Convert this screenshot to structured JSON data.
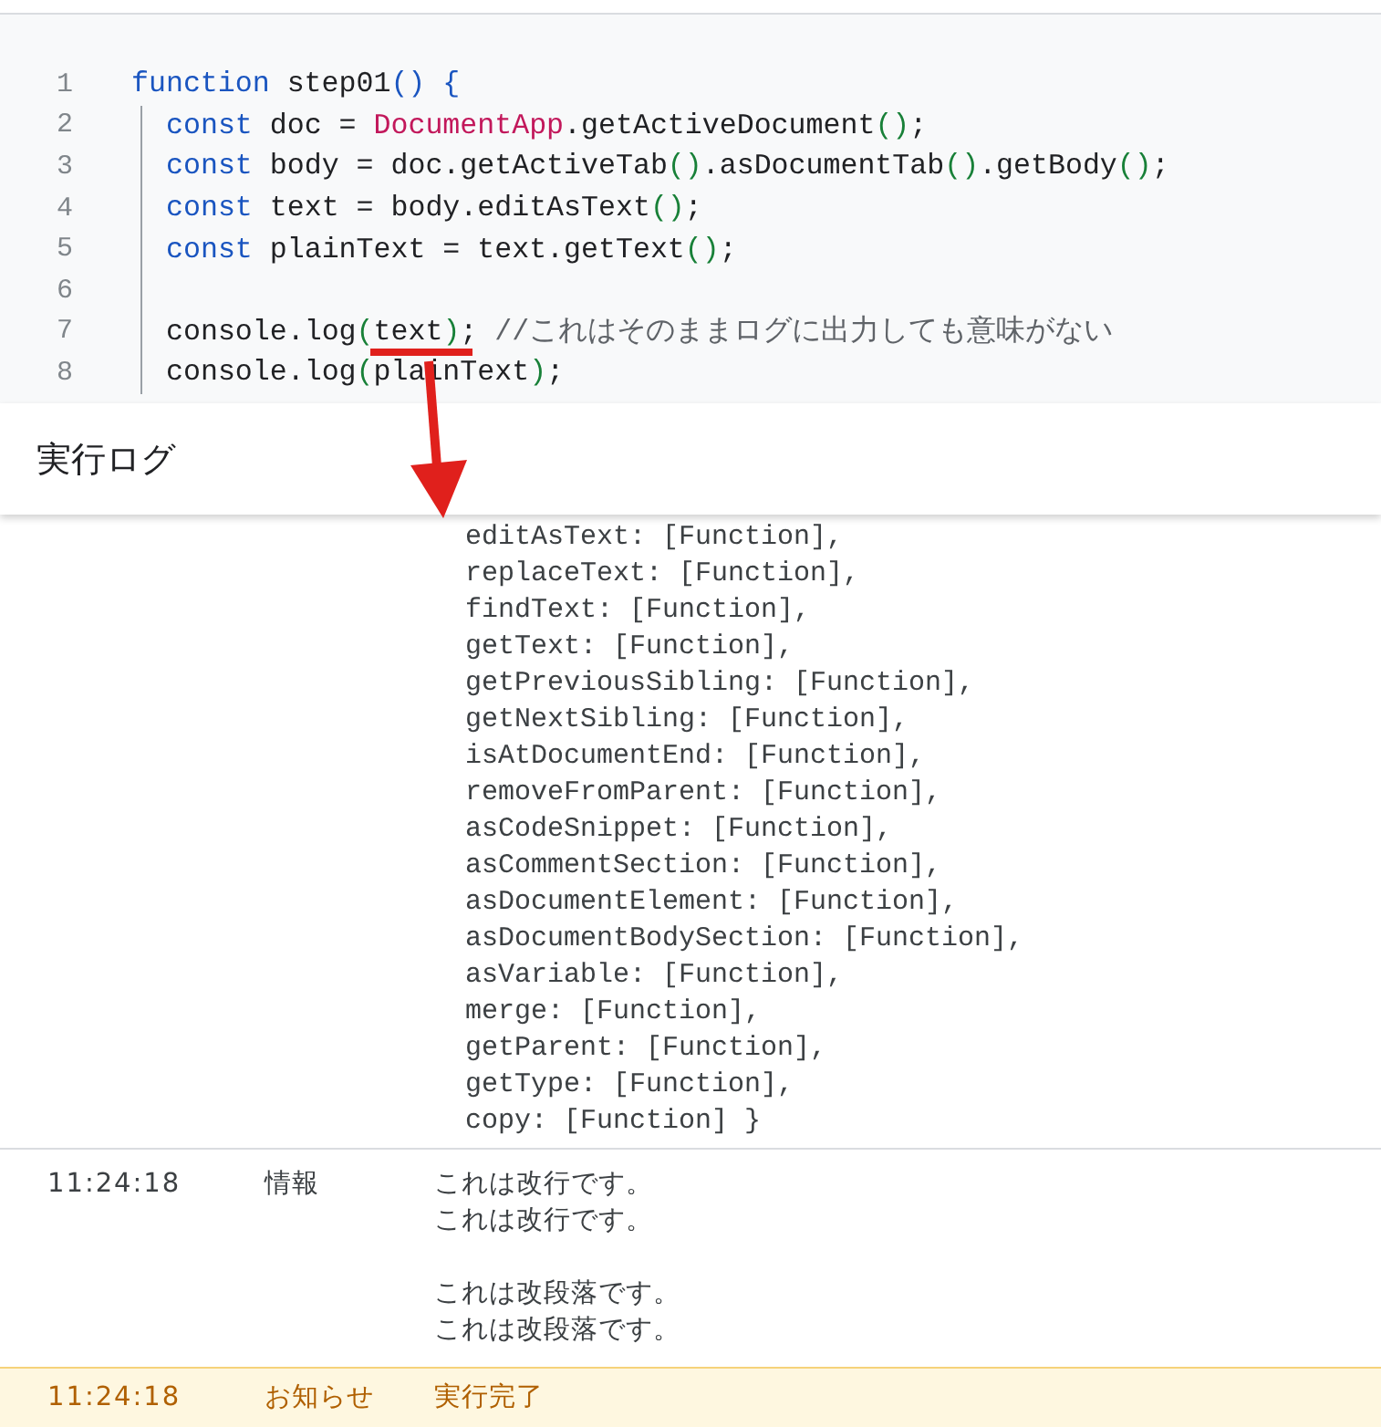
{
  "editor": {
    "lines": [
      {
        "number": "1",
        "indented": false,
        "tokens": [
          {
            "kind": "keyword",
            "text": "function"
          },
          {
            "kind": "plain",
            "text": " step01"
          },
          {
            "kind": "bracket",
            "text": "() {"
          }
        ]
      },
      {
        "number": "2",
        "indented": true,
        "tokens": [
          {
            "kind": "keyword",
            "text": "const"
          },
          {
            "kind": "plain",
            "text": " doc = "
          },
          {
            "kind": "class",
            "text": "DocumentApp"
          },
          {
            "kind": "plain",
            "text": ".getActiveDocument"
          },
          {
            "kind": "paren",
            "text": "()"
          },
          {
            "kind": "plain",
            "text": ";"
          }
        ]
      },
      {
        "number": "3",
        "indented": true,
        "tokens": [
          {
            "kind": "keyword",
            "text": "const"
          },
          {
            "kind": "plain",
            "text": " body = doc.getActiveTab"
          },
          {
            "kind": "paren",
            "text": "()"
          },
          {
            "kind": "plain",
            "text": ".asDocumentTab"
          },
          {
            "kind": "paren",
            "text": "()"
          },
          {
            "kind": "plain",
            "text": ".getBody"
          },
          {
            "kind": "paren",
            "text": "()"
          },
          {
            "kind": "plain",
            "text": ";"
          }
        ]
      },
      {
        "number": "4",
        "indented": true,
        "tokens": [
          {
            "kind": "keyword",
            "text": "const"
          },
          {
            "kind": "plain",
            "text": " text = body.editAsText"
          },
          {
            "kind": "paren",
            "text": "()"
          },
          {
            "kind": "plain",
            "text": ";"
          }
        ]
      },
      {
        "number": "5",
        "indented": true,
        "tokens": [
          {
            "kind": "keyword",
            "text": "const"
          },
          {
            "kind": "plain",
            "text": " plainText = text.getText"
          },
          {
            "kind": "paren",
            "text": "()"
          },
          {
            "kind": "plain",
            "text": ";"
          }
        ]
      },
      {
        "number": "6",
        "indented": true
      },
      {
        "number": "7",
        "indented": true,
        "tokens": [
          {
            "kind": "plain",
            "text": "console.log"
          },
          {
            "kind": "paren",
            "text": "("
          },
          {
            "kind": "plain",
            "text": "text"
          },
          {
            "kind": "paren",
            "text": ")"
          },
          {
            "kind": "plain",
            "text": "; "
          },
          {
            "kind": "comment",
            "text": "//これはそのままログに出力しても意味がない"
          }
        ]
      },
      {
        "number": "8",
        "indented": true,
        "tokens": [
          {
            "kind": "plain",
            "text": "console.log"
          },
          {
            "kind": "paren",
            "text": "("
          },
          {
            "kind": "plain",
            "text": "plainText"
          },
          {
            "kind": "paren",
            "text": ")"
          },
          {
            "kind": "plain",
            "text": ";"
          }
        ]
      }
    ]
  },
  "log_panel": {
    "title": "実行ログ",
    "output_lines": [
      "editAsText: [Function],",
      "replaceText: [Function],",
      "findText: [Function],",
      "getText: [Function],",
      "getPreviousSibling: [Function],",
      "getNextSibling: [Function],",
      "isAtDocumentEnd: [Function],",
      "removeFromParent: [Function],",
      "asCodeSnippet: [Function],",
      "asCommentSection: [Function],",
      "asDocumentElement: [Function],",
      "asDocumentBodySection: [Function],",
      "asVariable: [Function],",
      "merge: [Function],",
      "getParent: [Function],",
      "getType: [Function],",
      "copy: [Function] }"
    ],
    "entries": [
      {
        "kind": "info",
        "time": "11:24:18",
        "level": "情報",
        "paragraphs": [
          [
            "これは改行です。",
            "これは改行です。"
          ],
          [
            "これは改段落です。",
            "これは改段落です。"
          ]
        ]
      },
      {
        "kind": "notice",
        "time": "11:24:18",
        "level": "お知らせ",
        "paragraphs": [
          [
            "実行完了"
          ]
        ]
      }
    ]
  }
}
